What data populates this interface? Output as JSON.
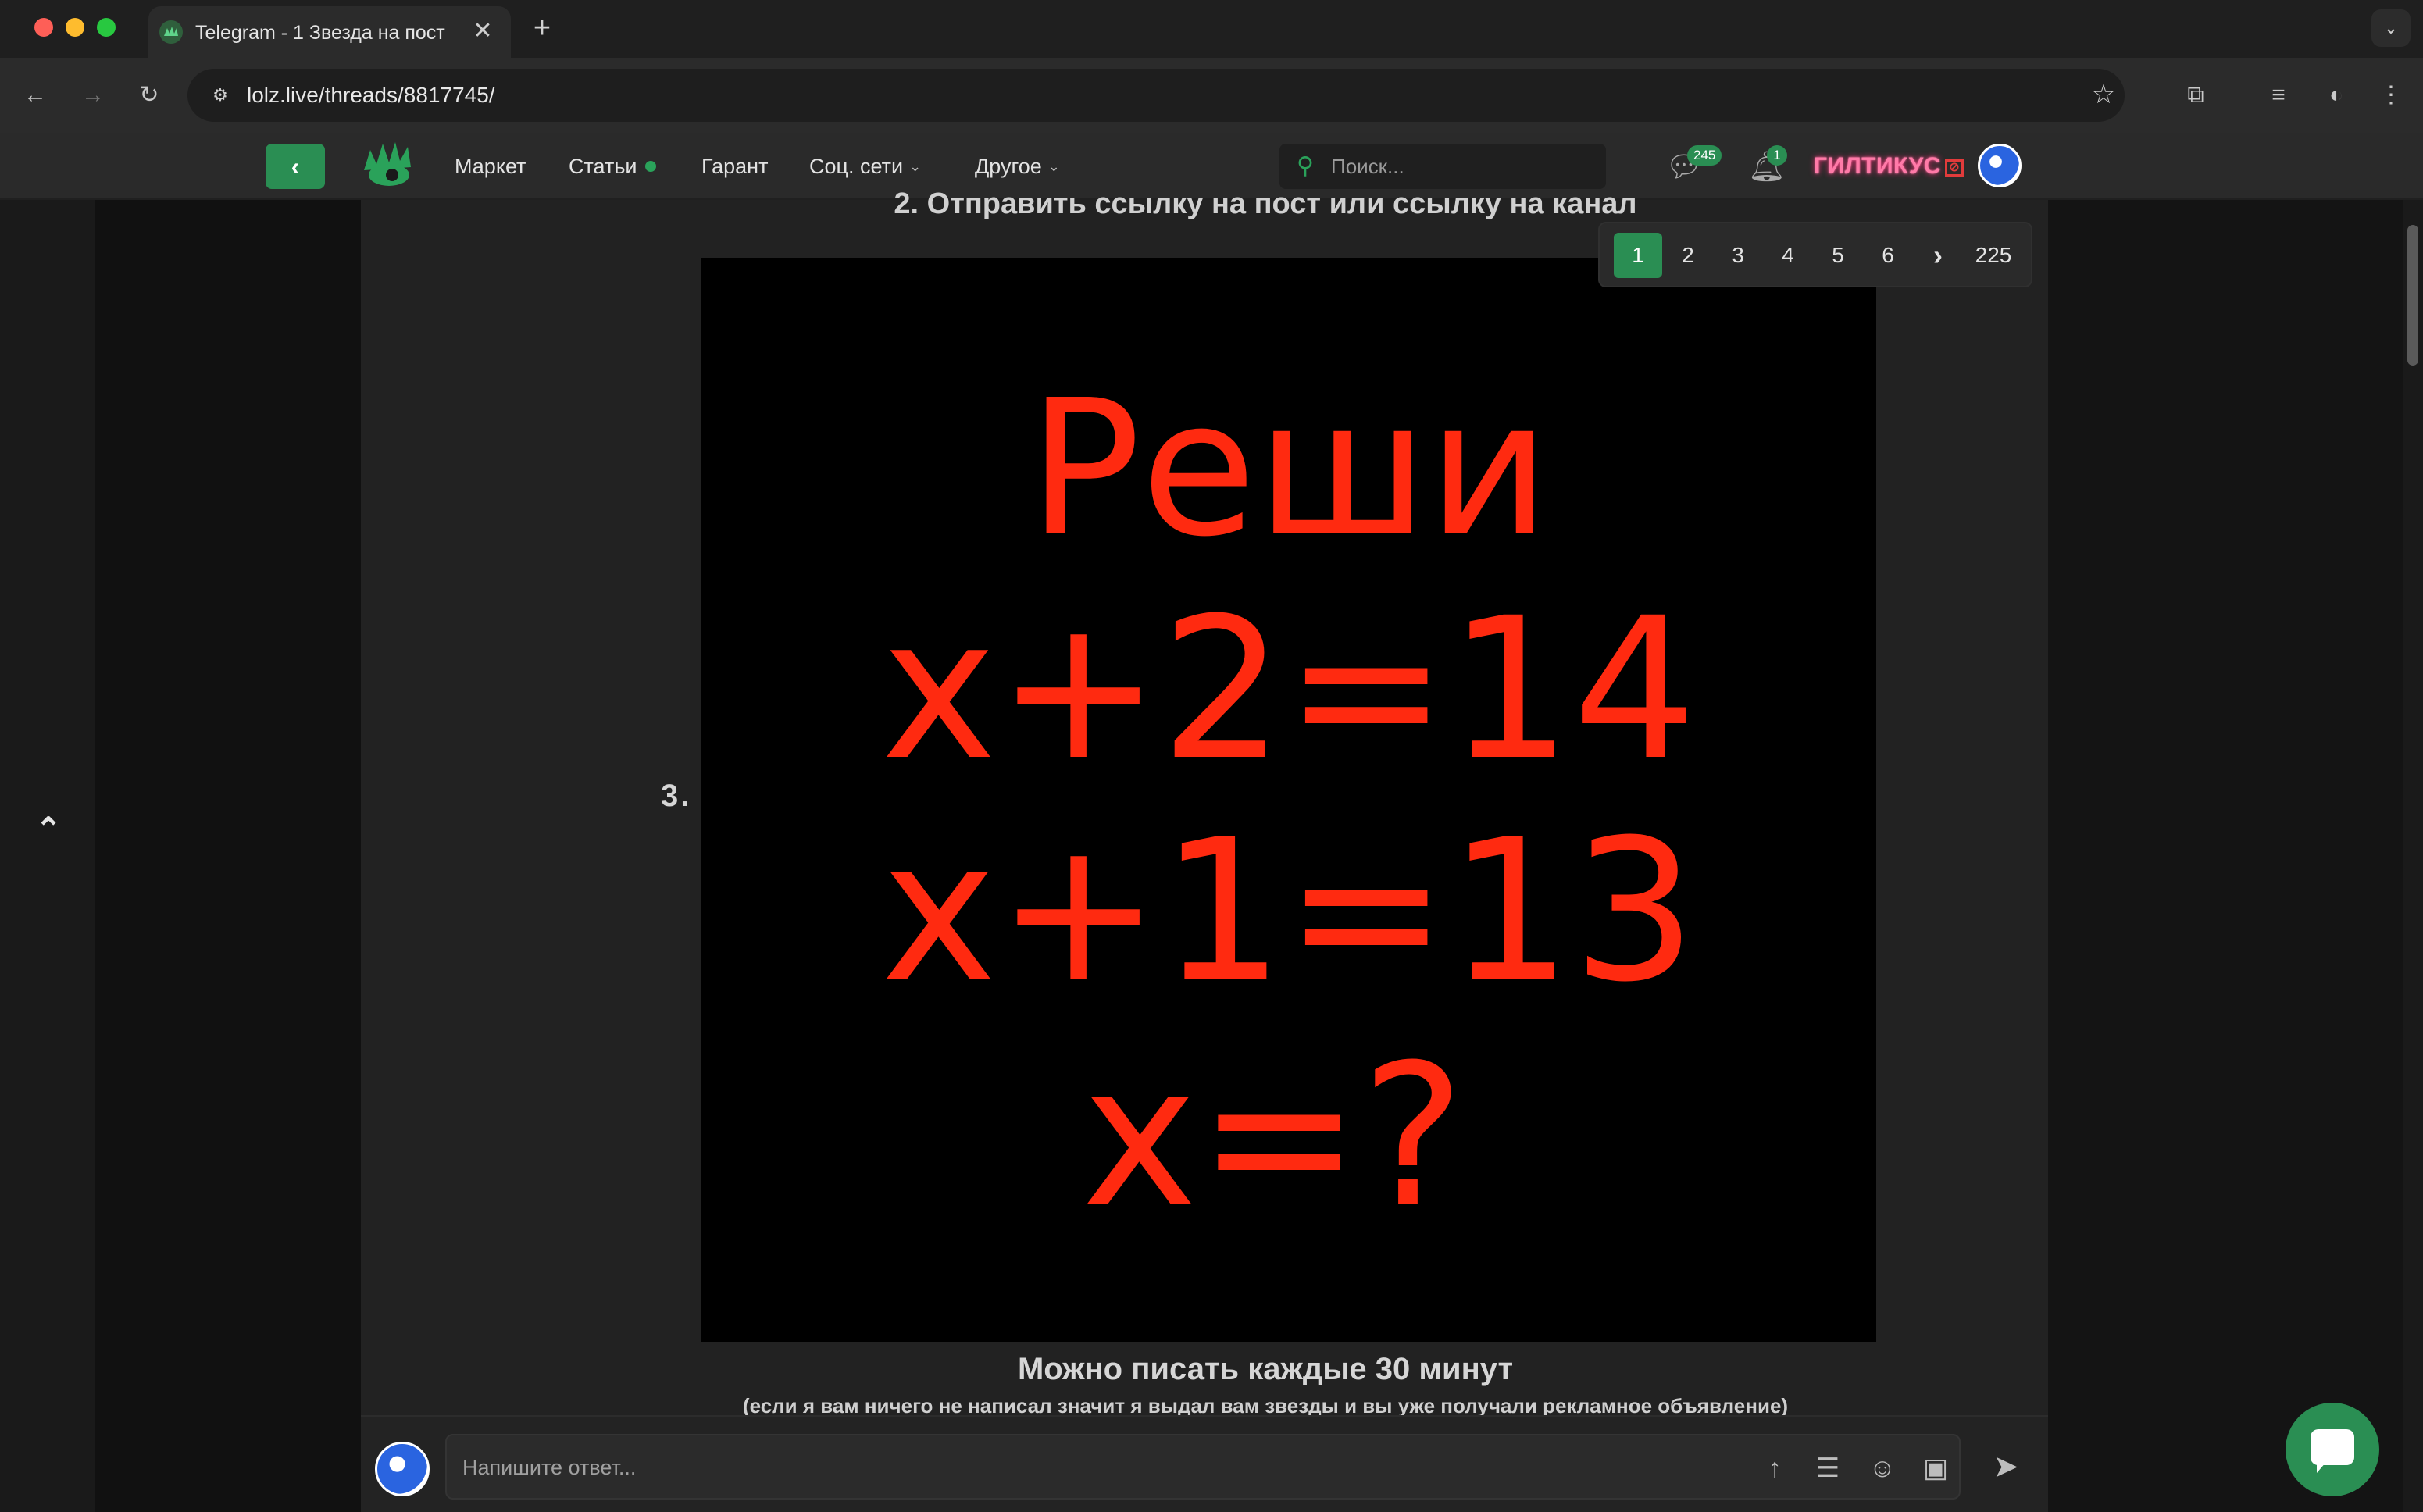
{
  "browser": {
    "tab_title": "Telegram - 1 Звезда на пост",
    "url": "lolz.live/threads/8817745/"
  },
  "header": {
    "nav": {
      "market": "Маркет",
      "articles": "Статьи",
      "guarantor": "Гарант",
      "social": "Соц. сети",
      "other": "Другое"
    },
    "search_placeholder": "Поиск...",
    "messages_count": "245",
    "notifications_count": "1",
    "username": "ГИЛТИКУС"
  },
  "post": {
    "step2_text": "2. Отправить ссылку на пост или ссылку на канал",
    "step3_label": "3.",
    "image_lines": [
      "Реши",
      "x+2=14",
      "x+1=13",
      "x=?"
    ],
    "note_main": "Можно писать каждые 30 минут",
    "note_sub": "(если я вам ничего не написал значит я выдал вам звезды и вы уже получали рекламное объявление)"
  },
  "pagination": {
    "pages": [
      "1",
      "2",
      "3",
      "4",
      "5",
      "6"
    ],
    "next": "›",
    "last": "225",
    "current": "1"
  },
  "reply": {
    "placeholder": "Напишите ответ..."
  },
  "colors": {
    "accent": "#2a8e53",
    "image_text": "#ff2a10",
    "username_glow": "#ff2f7a"
  }
}
